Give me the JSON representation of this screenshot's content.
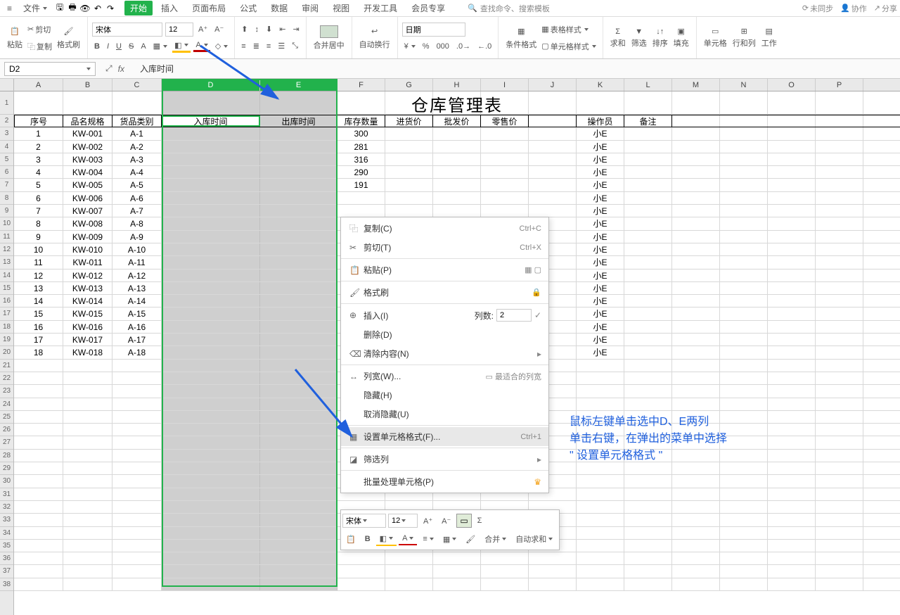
{
  "topbar": {
    "file_menu": "文件",
    "tabs": [
      "开始",
      "插入",
      "页面布局",
      "公式",
      "数据",
      "审阅",
      "视图",
      "开发工具",
      "会员专享"
    ],
    "active_tab": 0,
    "search_placeholder": "查找命令、搜索模板",
    "right": {
      "unsync": "未同步",
      "coop": "协作",
      "share": "分享"
    }
  },
  "ribbon": {
    "paste": "粘贴",
    "cut": "剪切",
    "copy": "复制",
    "fmtpaint": "格式刷",
    "font": "宋体",
    "size": "12",
    "merge": "合并居中",
    "wrap": "自动换行",
    "numfmt": "日期",
    "cond": "条件格式",
    "tablestyle": "表格样式",
    "cellstyle": "单元格样式",
    "sum": "求和",
    "filter": "筛选",
    "sort": "排序",
    "fill": "填充",
    "cells": "单元格",
    "rowcol": "行和列",
    "worksh": "工作"
  },
  "formula_bar": {
    "namebox": "D2",
    "content": "入库时间"
  },
  "columns": [
    "A",
    "B",
    "C",
    "D",
    "E",
    "F",
    "G",
    "H",
    "I",
    "J",
    "K",
    "L",
    "M",
    "N",
    "O",
    "P"
  ],
  "title": "仓库管理表",
  "headers": [
    "序号",
    "品名规格",
    "货品类别",
    "入库时间",
    "出库时间",
    "库存数量",
    "进货价",
    "批发价",
    "零售价",
    "",
    "操作员",
    "备注"
  ],
  "rows": [
    {
      "n": "1",
      "pm": "KW-001",
      "cat": "A-1",
      "stock": "300",
      "op": "小E"
    },
    {
      "n": "2",
      "pm": "KW-002",
      "cat": "A-2",
      "stock": "281",
      "op": "小E"
    },
    {
      "n": "3",
      "pm": "KW-003",
      "cat": "A-3",
      "stock": "316",
      "op": "小E"
    },
    {
      "n": "4",
      "pm": "KW-004",
      "cat": "A-4",
      "stock": "290",
      "op": "小E"
    },
    {
      "n": "5",
      "pm": "KW-005",
      "cat": "A-5",
      "stock": "191",
      "op": "小E"
    },
    {
      "n": "6",
      "pm": "KW-006",
      "cat": "A-6",
      "stock": "",
      "op": "小E"
    },
    {
      "n": "7",
      "pm": "KW-007",
      "cat": "A-7",
      "stock": "",
      "op": "小E"
    },
    {
      "n": "8",
      "pm": "KW-008",
      "cat": "A-8",
      "stock": "",
      "op": "小E"
    },
    {
      "n": "9",
      "pm": "KW-009",
      "cat": "A-9",
      "stock": "",
      "op": "小E"
    },
    {
      "n": "10",
      "pm": "KW-010",
      "cat": "A-10",
      "stock": "",
      "op": "小E"
    },
    {
      "n": "11",
      "pm": "KW-011",
      "cat": "A-11",
      "stock": "",
      "op": "小E"
    },
    {
      "n": "12",
      "pm": "KW-012",
      "cat": "A-12",
      "stock": "",
      "op": "小E"
    },
    {
      "n": "13",
      "pm": "KW-013",
      "cat": "A-13",
      "stock": "",
      "op": "小E"
    },
    {
      "n": "14",
      "pm": "KW-014",
      "cat": "A-14",
      "stock": "",
      "op": "小E"
    },
    {
      "n": "15",
      "pm": "KW-015",
      "cat": "A-15",
      "stock": "",
      "op": "小E"
    },
    {
      "n": "16",
      "pm": "KW-016",
      "cat": "A-16",
      "stock": "",
      "op": "小E"
    },
    {
      "n": "17",
      "pm": "KW-017",
      "cat": "A-17",
      "stock": "",
      "op": "小E"
    },
    {
      "n": "18",
      "pm": "KW-018",
      "cat": "A-18",
      "stock": "",
      "op": "小E"
    }
  ],
  "context_menu": {
    "copy": {
      "label": "复制(C)",
      "sc": "Ctrl+C"
    },
    "cut": {
      "label": "剪切(T)",
      "sc": "Ctrl+X"
    },
    "paste": {
      "label": "粘贴(P)"
    },
    "fmtpaint": {
      "label": "格式刷"
    },
    "insert": {
      "label": "插入(I)",
      "cols_label": "列数:",
      "cols_val": "2"
    },
    "delete": {
      "label": "删除(D)"
    },
    "clear": {
      "label": "清除内容(N)"
    },
    "colwidth": {
      "label": "列宽(W)..."
    },
    "bestfit": {
      "label": "最适合的列宽"
    },
    "hide": {
      "label": "隐藏(H)"
    },
    "unhide": {
      "label": "取消隐藏(U)"
    },
    "formatcells": {
      "label": "设置单元格格式(F)...",
      "sc": "Ctrl+1"
    },
    "filter": {
      "label": "筛选列"
    },
    "batch": {
      "label": "批量处理单元格(P)"
    }
  },
  "mini_toolbar": {
    "font": "宋体",
    "size": "12",
    "merge": "合并",
    "autosum": "自动求和"
  },
  "annotations": {
    "line1": "鼠标左键单击选中D、E两列",
    "line2": "单击右键，在弹出的菜单中选择",
    "line3": "\" 设置单元格格式 \""
  }
}
